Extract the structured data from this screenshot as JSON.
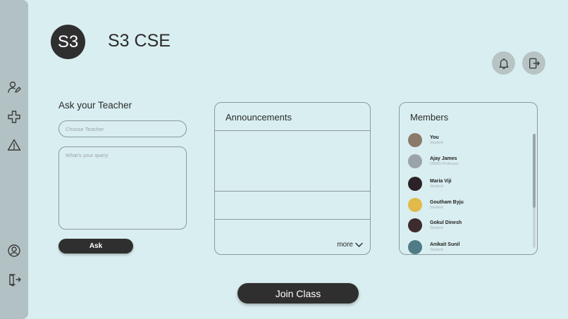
{
  "sidebar": {
    "icons": [
      "edit-user-icon",
      "add-icon",
      "warning-icon",
      "profile-icon",
      "logout-icon"
    ]
  },
  "header": {
    "avatar_text": "S3",
    "class_name": "S3 CSE",
    "icons": [
      "bell-icon",
      "exit-icon"
    ]
  },
  "ask": {
    "heading": "Ask your Teacher",
    "teacher_placeholder": "Choose Teacher",
    "query_placeholder": "What's your query",
    "button_label": "Ask"
  },
  "announcements": {
    "title": "Announcements",
    "more_label": "more"
  },
  "members": {
    "title": "Members",
    "list": [
      {
        "name": "You",
        "role": "Student",
        "color": "#8b7a6a"
      },
      {
        "name": "Ajay James",
        "role": "DBMS Professor",
        "color": "#9aa3a8"
      },
      {
        "name": "Maria Viji",
        "role": "Student",
        "color": "#2a2226"
      },
      {
        "name": "Goutham Byju",
        "role": "Student",
        "color": "#e2b94a"
      },
      {
        "name": "Gokul Dinesh",
        "role": "Student",
        "color": "#3d2b2e"
      },
      {
        "name": "Anikait Sunil",
        "role": "Student",
        "color": "#4f7c86"
      }
    ]
  },
  "join_button": "Join Class",
  "colors": {
    "background": "#d9eef0",
    "sidebar": "#b2c2c4",
    "dark": "#2f2f2f"
  }
}
